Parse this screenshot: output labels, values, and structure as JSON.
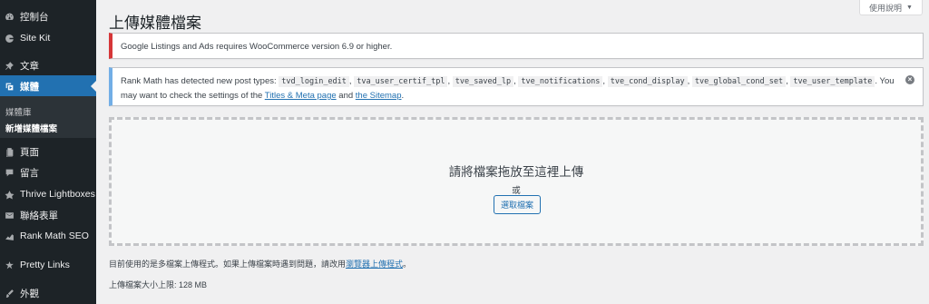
{
  "sidebar": {
    "items": [
      {
        "label": "控制台",
        "icon": "dashboard-icon"
      },
      {
        "label": "Site Kit",
        "icon": "site-kit-icon"
      },
      {
        "label": "文章",
        "icon": "pin-icon"
      },
      {
        "label": "媒體",
        "icon": "media-icon"
      },
      {
        "label": "頁面",
        "icon": "page-icon"
      },
      {
        "label": "留言",
        "icon": "comment-icon"
      },
      {
        "label": "Thrive Lightboxes",
        "icon": "thrive-icon"
      },
      {
        "label": "聯絡表單",
        "icon": "mail-icon"
      },
      {
        "label": "Rank Math SEO",
        "icon": "rank-math-icon"
      },
      {
        "label": "Pretty Links",
        "icon": "pretty-links-icon"
      },
      {
        "label": "外觀",
        "icon": "appearance-icon"
      }
    ],
    "submenu": [
      {
        "label": "媒體庫"
      },
      {
        "label": "新增媒體檔案"
      }
    ]
  },
  "help": {
    "label": "使用說明"
  },
  "page": {
    "title": "上傳媒體檔案"
  },
  "notices": {
    "woo": "Google Listings and Ads requires WooCommerce version 6.9 or higher.",
    "rankmath": {
      "intro": "Rank Math has detected new post types: ",
      "types": [
        "tvd_login_edit",
        "tva_user_certif_tpl",
        "tve_saved_lp",
        "tve_notifications",
        "tve_cond_display",
        "tve_global_cond_set",
        "tve_user_template"
      ],
      "sep": ", ",
      "outro_1": ". You may want to check the settings of the ",
      "link_1": "Titles & Meta page",
      "and": " and ",
      "link_2": "the Sitemap",
      "end": "."
    }
  },
  "upload": {
    "drop_title": "請將檔案拖放至這裡上傳",
    "or": "或",
    "select_button": "選取檔案",
    "info_text": "目前使用的是多檔案上傳程式。如果上傳檔案時遇到問題，請改用",
    "info_link": "瀏覽器上傳程式",
    "info_end": "。",
    "max_size": "上傳檔案大小上限: 128 MB"
  },
  "colors": {
    "sidebar_bg": "#1d2327",
    "active": "#2271b1",
    "error_border": "#d63638",
    "info_border": "#72aee6",
    "link": "#2271b1"
  }
}
